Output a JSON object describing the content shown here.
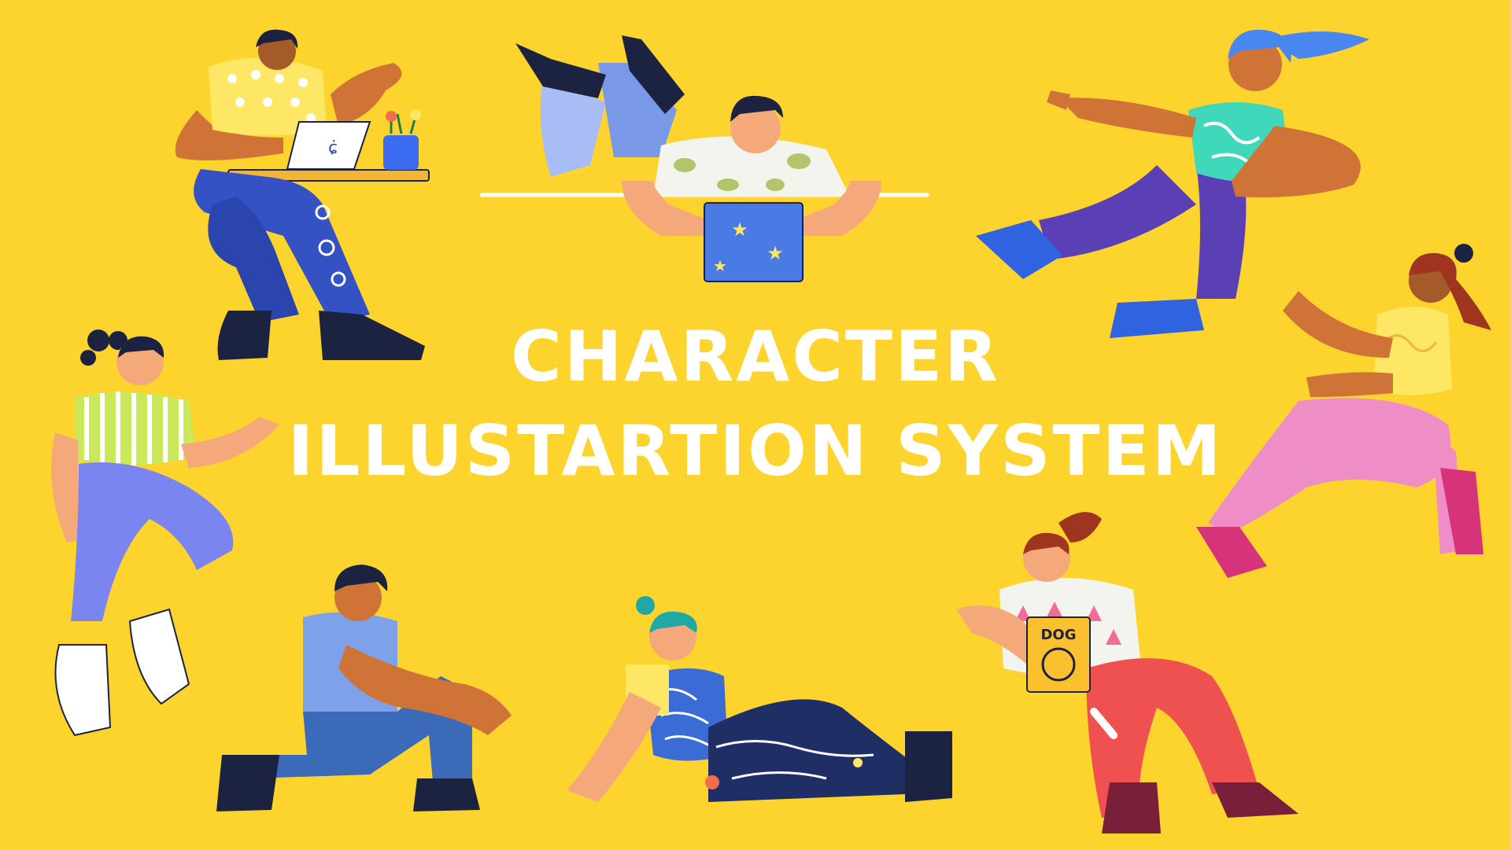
{
  "title": {
    "line1": "CHARACTER",
    "line2": "ILLUSTARTION SYSTEM"
  },
  "book_label": "DOG",
  "laptop_logo": "ɕ̇",
  "colors": {
    "background": "#fdd42e",
    "title": "#ffffff",
    "outline": "#1c2340"
  }
}
